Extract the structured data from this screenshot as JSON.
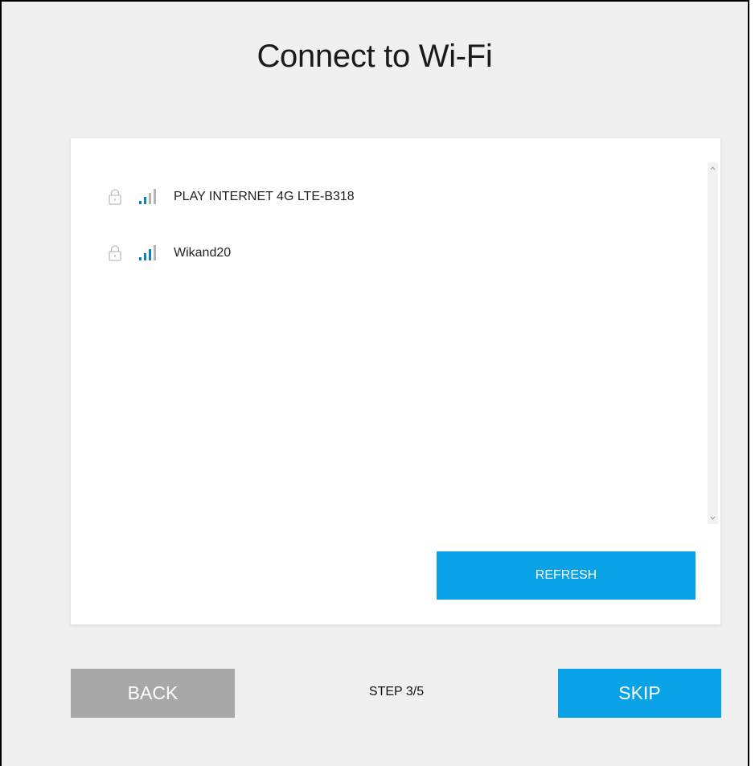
{
  "page": {
    "title": "Connect to Wi-Fi"
  },
  "networks": [
    {
      "ssid": "PLAY INTERNET 4G LTE-B318",
      "locked": true,
      "signal_bars": 2,
      "icons": [
        "lock-icon",
        "wifi-signal-icon"
      ]
    },
    {
      "ssid": "Wikand20",
      "locked": true,
      "signal_bars": 3,
      "icons": [
        "lock-icon",
        "wifi-signal-icon"
      ]
    }
  ],
  "actions": {
    "refresh_label": "REFRESH",
    "back_label": "BACK",
    "skip_label": "SKIP"
  },
  "footer": {
    "step_label": "STEP 3/5"
  },
  "colors": {
    "accent": "#0aa3e8",
    "back_button": "#a8a8a8",
    "background": "#f0f0f0",
    "card": "#ffffff",
    "signal_active": "#0a7fc2",
    "signal_inactive": "#b5b5b5"
  }
}
